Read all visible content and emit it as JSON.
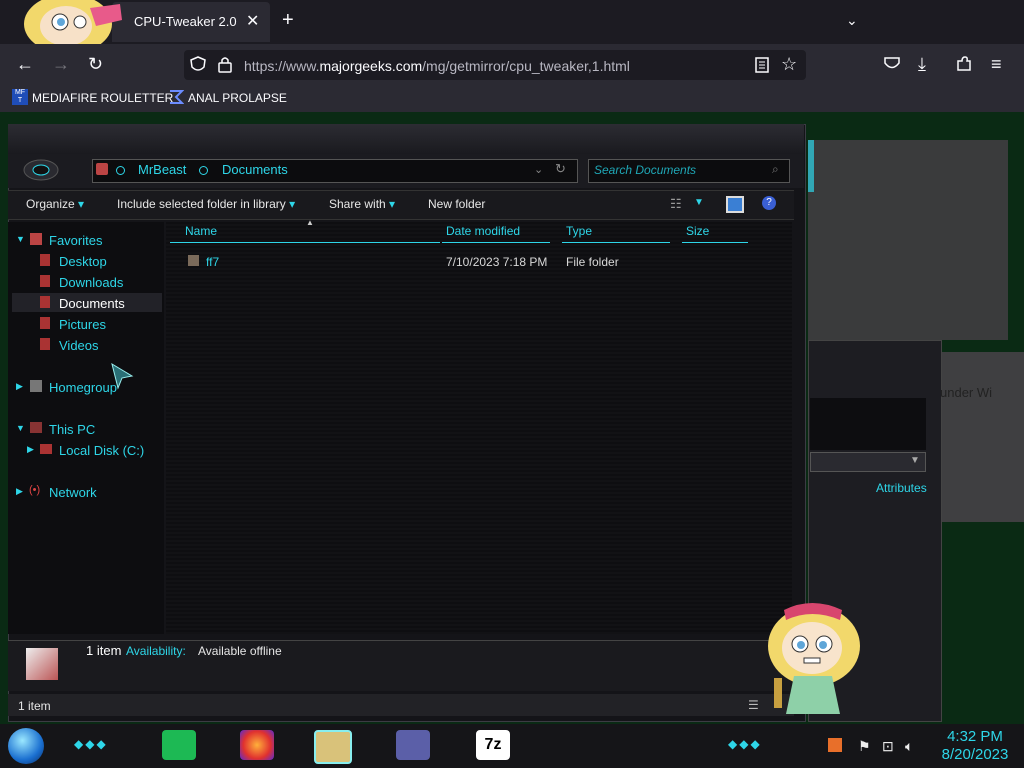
{
  "browser": {
    "tab_title": "CPU-Tweaker 2.0",
    "tab_close": "✕",
    "new_tab": "+",
    "tab_list": "⌄",
    "nav_back": "←",
    "nav_forward": "→",
    "nav_reload": "↻",
    "url_prefix": "https://www.",
    "url_domain": "majorgeeks.com",
    "url_path": "/mg/getmirror/cpu_tweaker,1.html",
    "bookmarks": [
      "MEDIAFIRE ROULETTER",
      "ANAL PROLAPSE"
    ]
  },
  "explorer": {
    "breadcrumb": [
      "MrBeast",
      "Documents"
    ],
    "search_placeholder": "Search Documents",
    "toolbar": {
      "organize": "Organize",
      "include": "Include selected folder in library",
      "share": "Share with",
      "new_folder": "New folder"
    },
    "nav": {
      "favorites": "Favorites",
      "desktop": "Desktop",
      "downloads": "Downloads",
      "documents": "Documents",
      "pictures": "Pictures",
      "videos": "Videos",
      "homegroup": "Homegroup",
      "this_pc": "This PC",
      "local_disk": "Local Disk (C:)",
      "network": "Network"
    },
    "columns": [
      "Name",
      "Date modified",
      "Type",
      "Size"
    ],
    "rows": [
      {
        "name": "ff7",
        "date": "7/10/2023 7:18 PM",
        "type": "File folder",
        "size": ""
      }
    ],
    "details": {
      "count": "1 item",
      "availability_label": "Availability:",
      "availability_value": "Available offline"
    },
    "status": "1 item"
  },
  "background_window": {
    "attributes_header": "Attributes",
    "text_fragment": "under Wi"
  },
  "taskbar": {
    "time": "4:32 PM",
    "date": "8/20/2023",
    "seven_zip": "7z"
  },
  "colors": {
    "accent": "#2ed6e8",
    "browser_bg": "#2b2a33",
    "page_green": "#0a2a14"
  }
}
